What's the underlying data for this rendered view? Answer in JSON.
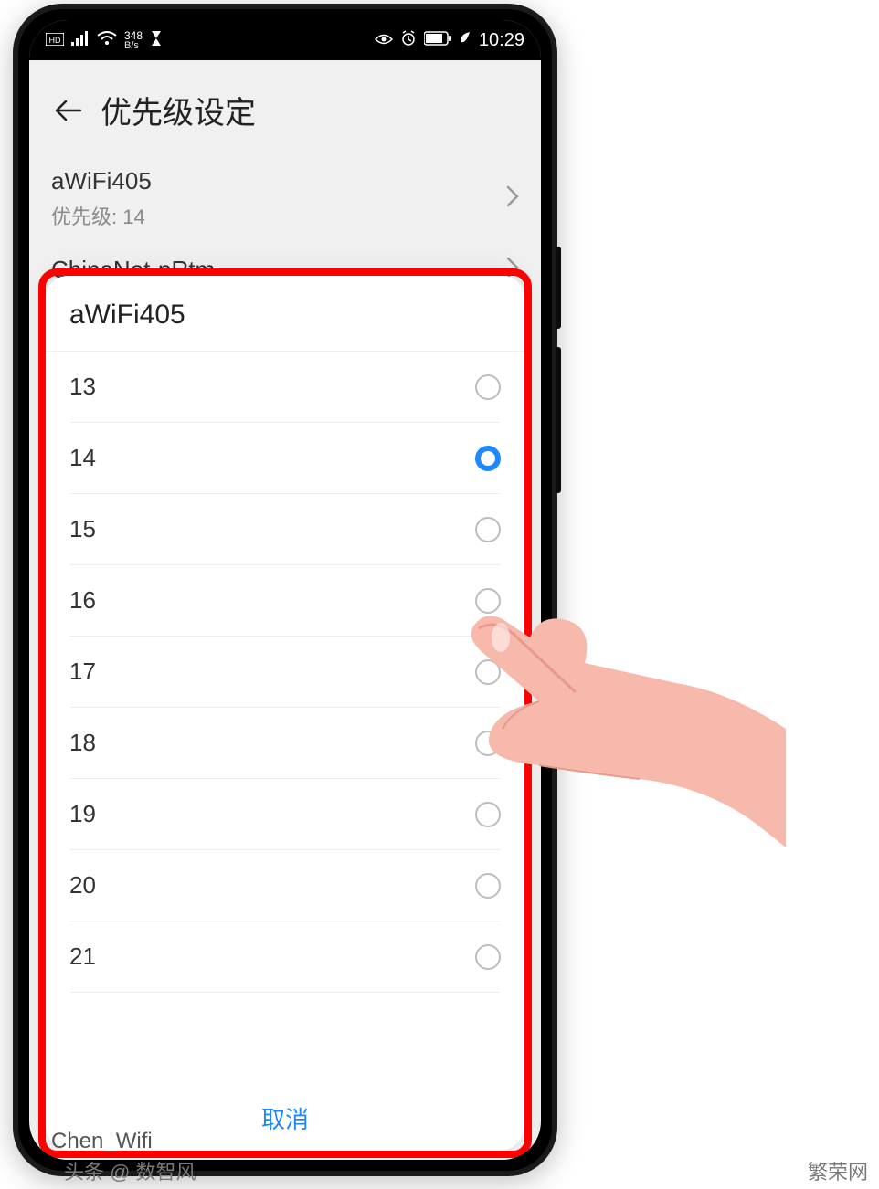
{
  "status": {
    "kbs_top": "348",
    "kbs_bottom": "B/s",
    "time": "10:29"
  },
  "header": {
    "title": "优先级设定"
  },
  "bg_list": {
    "items": [
      {
        "name": "aWiFi405",
        "sub": "优先级: 14"
      },
      {
        "name": "ChinaNet-pRtm",
        "sub": ""
      }
    ]
  },
  "dialog": {
    "title": "aWiFi405",
    "selected": "14",
    "options": [
      "13",
      "14",
      "15",
      "16",
      "17",
      "18",
      "19",
      "20",
      "21"
    ],
    "cancel": "取消"
  },
  "bottom_peek": "Chen_Wifi",
  "watermark": {
    "left": "头条 @ 数智风",
    "right": "繁荣网"
  }
}
